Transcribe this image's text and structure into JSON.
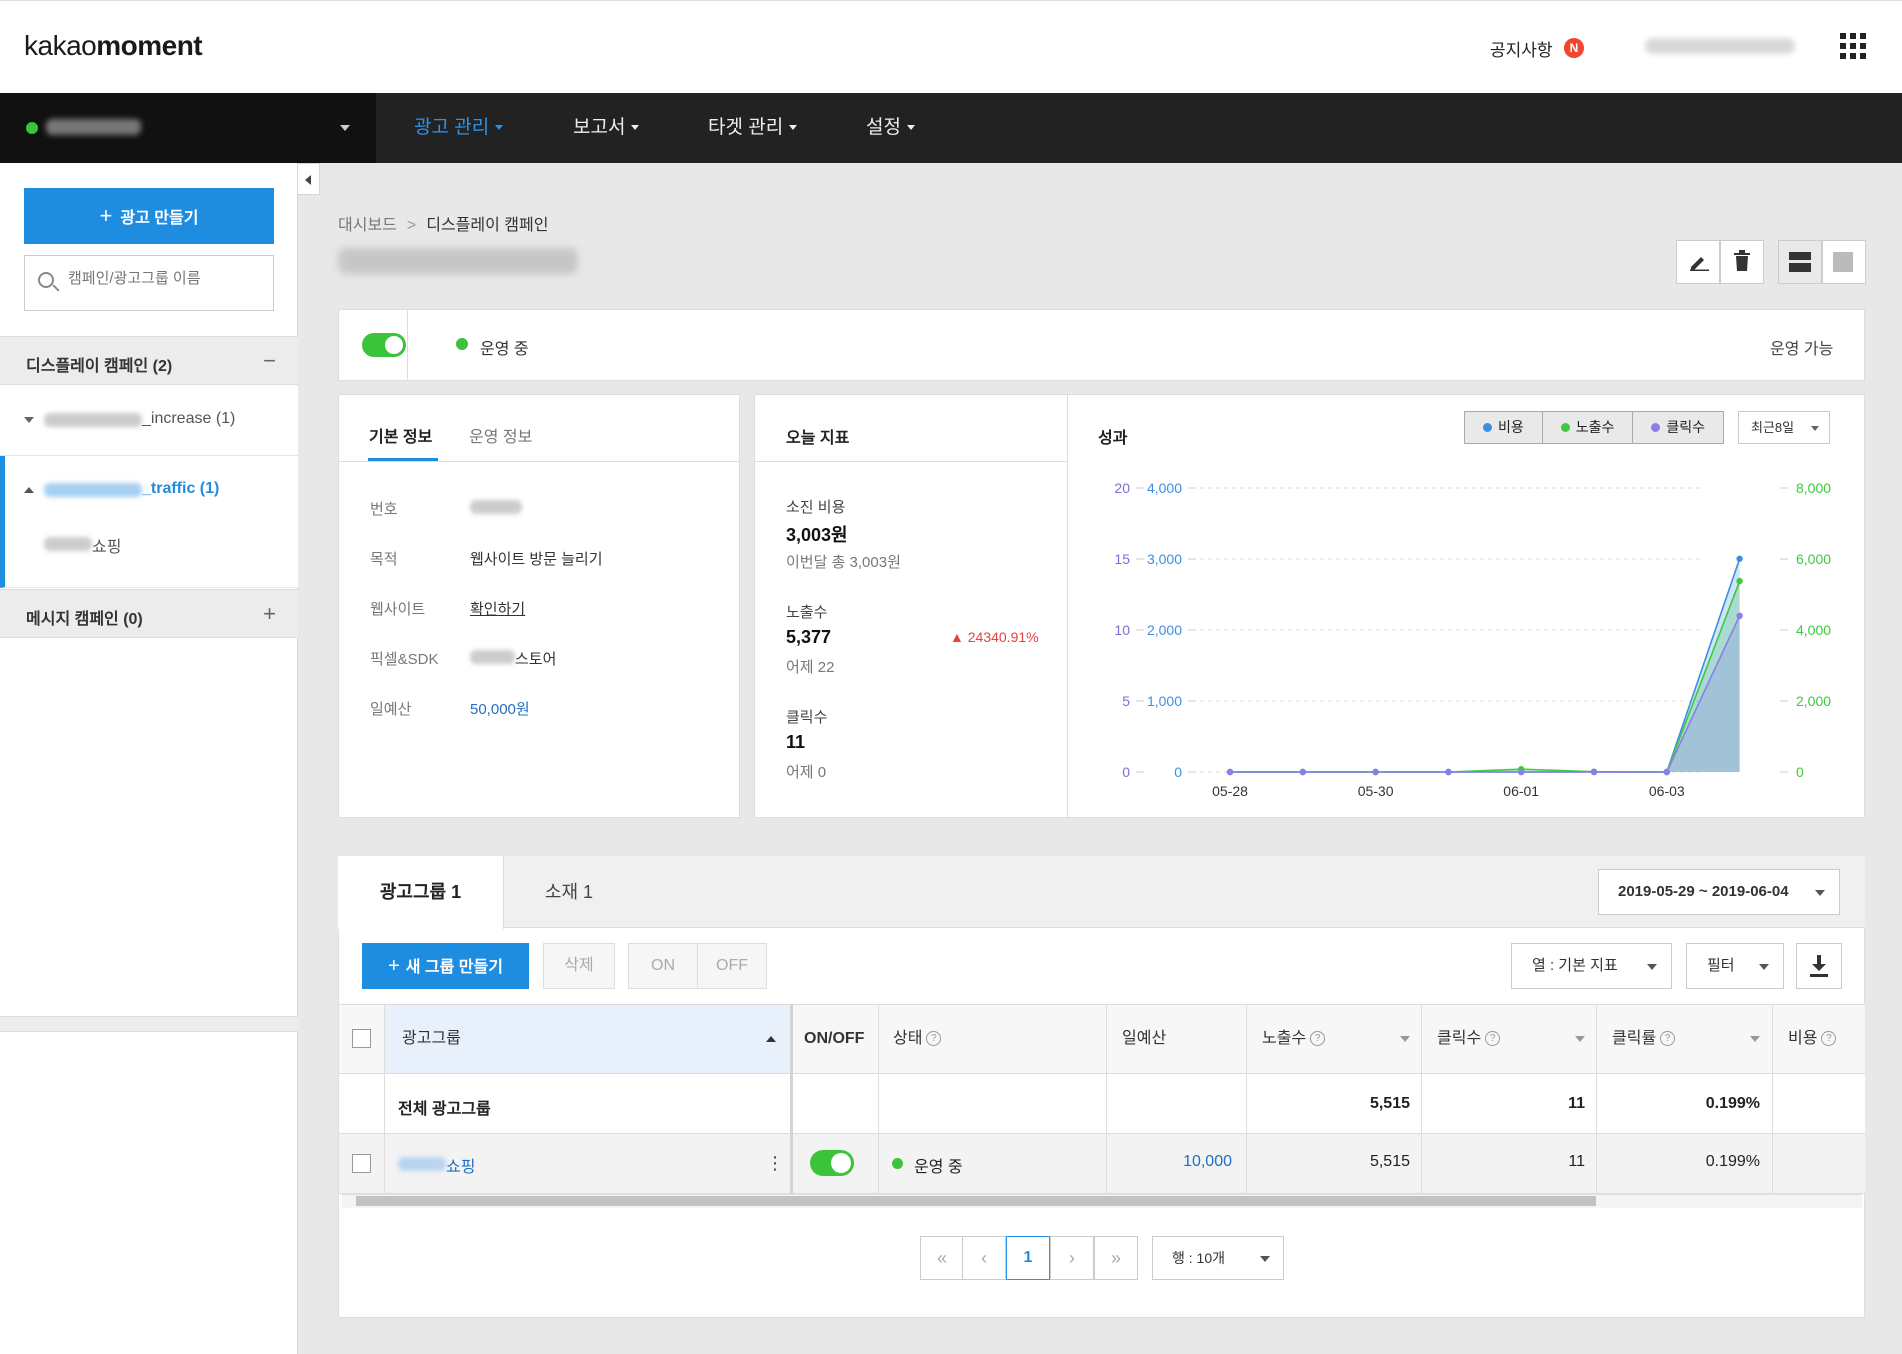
{
  "header": {
    "logo_regular": "kakao",
    "logo_bold": "moment",
    "notice_label": "공지사항",
    "notice_badge": "N"
  },
  "nav": {
    "items": [
      {
        "label": "광고 관리",
        "active": true
      },
      {
        "label": "보고서"
      },
      {
        "label": "타겟 관리"
      },
      {
        "label": "설정"
      }
    ]
  },
  "sidebar": {
    "create_label": "광고 만들기",
    "search_placeholder": "캠페인/광고그룹 이름",
    "display_section": "디스플레이 캠페인 (2)",
    "display_sign": "−",
    "campaigns": [
      {
        "label": "_increase (1)"
      },
      {
        "label": "_traffic (1)",
        "selected": true
      }
    ],
    "ad_group": "쇼핑",
    "message_section": "메시지 캠페인 (0)",
    "message_sign": "+"
  },
  "main": {
    "breadcrumb": [
      "대시보드",
      "디스플레이 캠페인"
    ],
    "breadcrumb_sep": ">",
    "status": {
      "state": "운영 중",
      "availability": "운영 가능",
      "toggle_on": true
    },
    "info": {
      "tabs": [
        "기본 정보",
        "운영 정보"
      ],
      "rows": {
        "num_label": "번호",
        "goal_label": "목적",
        "goal_value": "웹사이트 방문 늘리기",
        "site_label": "웹사이트",
        "site_value": "확인하기",
        "pixel_label": "픽셀&SDK",
        "pixel_value": "스토어",
        "budget_label": "일예산",
        "budget_value": "50,000원"
      }
    },
    "today": {
      "title": "오늘 지표",
      "metrics": [
        {
          "label": "소진 비용",
          "value": "3,003원",
          "sub": "이번달 총 3,003원"
        },
        {
          "label": "노출수",
          "value": "5,377",
          "sub": "어제 22",
          "delta": "24340.91%"
        },
        {
          "label": "클릭수",
          "value": "11",
          "sub": "어제 0"
        }
      ]
    },
    "performance": {
      "title": "성과",
      "legend": [
        {
          "label": "비용",
          "color": "#3b8fe0"
        },
        {
          "label": "노출수",
          "color": "#3ec93e"
        },
        {
          "label": "클릭수",
          "color": "#8a7ee8"
        }
      ],
      "range": "최근8일"
    }
  },
  "chart_data": {
    "type": "area",
    "x": [
      "05-28",
      "05-29",
      "05-30",
      "05-31",
      "06-01",
      "06-02",
      "06-03",
      "06-04"
    ],
    "xticks": [
      "05-28",
      "05-30",
      "06-01",
      "06-03"
    ],
    "series": [
      {
        "name": "비용",
        "axis": "left-cost",
        "color": "#3b8fe0",
        "values": [
          0,
          0,
          0,
          0,
          0,
          0,
          0,
          3003
        ]
      },
      {
        "name": "노출수",
        "axis": "right",
        "color": "#3ec93e",
        "values": [
          0,
          0,
          0,
          0,
          80,
          10,
          0,
          5377
        ]
      },
      {
        "name": "클릭수",
        "axis": "left-click",
        "color": "#8a7ee8",
        "values": [
          0,
          0,
          0,
          0,
          0,
          0,
          0,
          11
        ]
      }
    ],
    "y_click_ticks": [
      "0",
      "5",
      "10",
      "15",
      "20"
    ],
    "y_cost_ticks": [
      "0",
      "1,000",
      "2,000",
      "3,000",
      "4,000"
    ],
    "y_right_ticks": [
      "0",
      "2,000",
      "4,000",
      "6,000",
      "8,000"
    ],
    "ylim_click": [
      0,
      20
    ],
    "ylim_cost": [
      0,
      4000
    ],
    "ylim_right": [
      0,
      8000
    ],
    "grid": true
  },
  "table": {
    "tabs": [
      "광고그룹 1",
      "소재 1"
    ],
    "date_range": "2019-05-29 ~ 2019-06-04",
    "new_group_label": "새 그룹 만들기",
    "delete_label": "삭제",
    "on_label": "ON",
    "off_label": "OFF",
    "columns_label": "열 : 기본 지표",
    "filter_label": "필터",
    "headers": {
      "group": "광고그룹",
      "onoff": "ON/OFF",
      "status": "상태",
      "budget": "일예산",
      "impressions": "노출수",
      "clicks": "클릭수",
      "ctr": "클릭률",
      "cost": "비용"
    },
    "total_row": {
      "name": "전체 광고그룹",
      "impressions": "5,515",
      "clicks": "11",
      "ctr": "0.199%"
    },
    "rows": [
      {
        "name": "쇼핑",
        "toggle_on": true,
        "status": "운영 중",
        "budget": "10,000",
        "impressions": "5,515",
        "clicks": "11",
        "ctr": "0.199%"
      }
    ],
    "pagination": {
      "first": "«",
      "prev": "‹",
      "current": "1",
      "next": "›",
      "last": "»",
      "rows_label": "행 : 10개"
    }
  }
}
